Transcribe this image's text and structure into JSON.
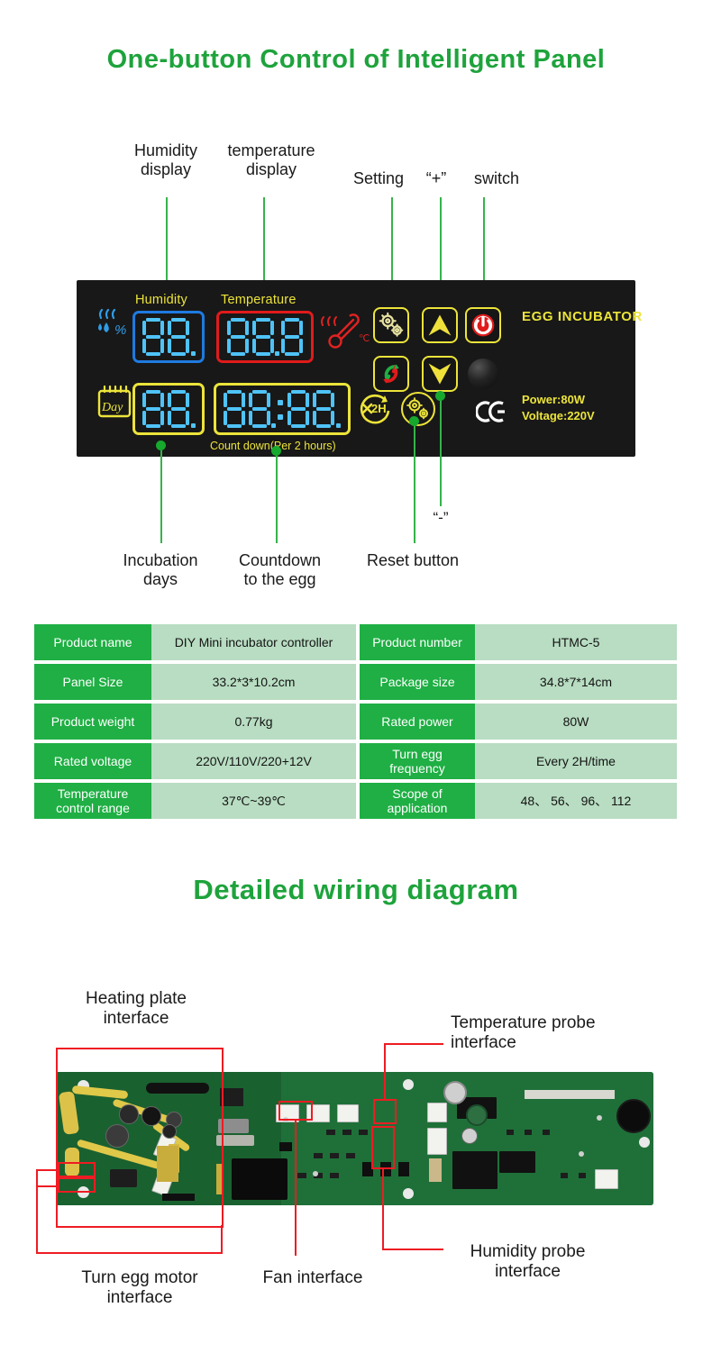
{
  "headings": {
    "main": "One-button Control of Intelligent Panel",
    "wiring": "Detailed wiring diagram"
  },
  "panel_callouts": {
    "top": [
      {
        "label": "Humidity\ndisplay"
      },
      {
        "label": "temperature\ndisplay"
      },
      {
        "label": "Setting"
      },
      {
        "label": "“+”"
      },
      {
        "label": "switch"
      }
    ],
    "bottom": [
      {
        "label": "Incubation\ndays"
      },
      {
        "label": "Countdown\nto the egg"
      },
      {
        "label": "Reset button"
      },
      {
        "label": "“-”"
      }
    ]
  },
  "panel": {
    "humidity_label": "Humidity",
    "temperature_label": "Temperature",
    "countdown_caption": "Count down(Per 2 hours)",
    "brand": "EGG INCUBATOR",
    "power_spec": "Power:80W\nVoltage:220V",
    "ce_mark": "CE",
    "day_icon_text": "Day",
    "turn_icon_text": "2H",
    "degree_unit": "℃",
    "humidity_unit": "%",
    "humidity_value": "88.",
    "temperature_value": "888",
    "days_value": "88.",
    "countdown_value": "88:88",
    "colors": {
      "panel_bg": "#181818",
      "segment": "#4fc3f7",
      "humidity_frame": "#1f7ae0",
      "temperature_frame": "#e01b1b",
      "yellow_frame": "#ece43a",
      "leader": "#36b34a",
      "heading": "#1ea33c"
    }
  },
  "spec_table": {
    "rows": [
      {
        "k1": "Product name",
        "v1": "DIY Mini incubator controller",
        "k2": "Product number",
        "v2": "HTMC-5"
      },
      {
        "k1": "Panel Size",
        "v1": "33.2*3*10.2cm",
        "k2": "Package size",
        "v2": "34.8*7*14cm"
      },
      {
        "k1": "Product weight",
        "v1": "0.77kg",
        "k2": "Rated power",
        "v2": "80W"
      },
      {
        "k1": "Rated voltage",
        "v1": "220V/110V/220+12V",
        "k2": "Turn egg frequency",
        "v2": "Every 2H/time"
      },
      {
        "k1": "Temperature control range",
        "v1": "37℃~39℃",
        "k2": "Scope of application",
        "v2": "48、 56、 96、 112"
      }
    ]
  },
  "wiring_callouts": [
    {
      "label": "Heating plate\ninterface"
    },
    {
      "label": "Temperature probe\ninterface"
    },
    {
      "label": "Turn egg motor\ninterface"
    },
    {
      "label": "Fan interface"
    },
    {
      "label": "Humidity probe\ninterface"
    }
  ]
}
